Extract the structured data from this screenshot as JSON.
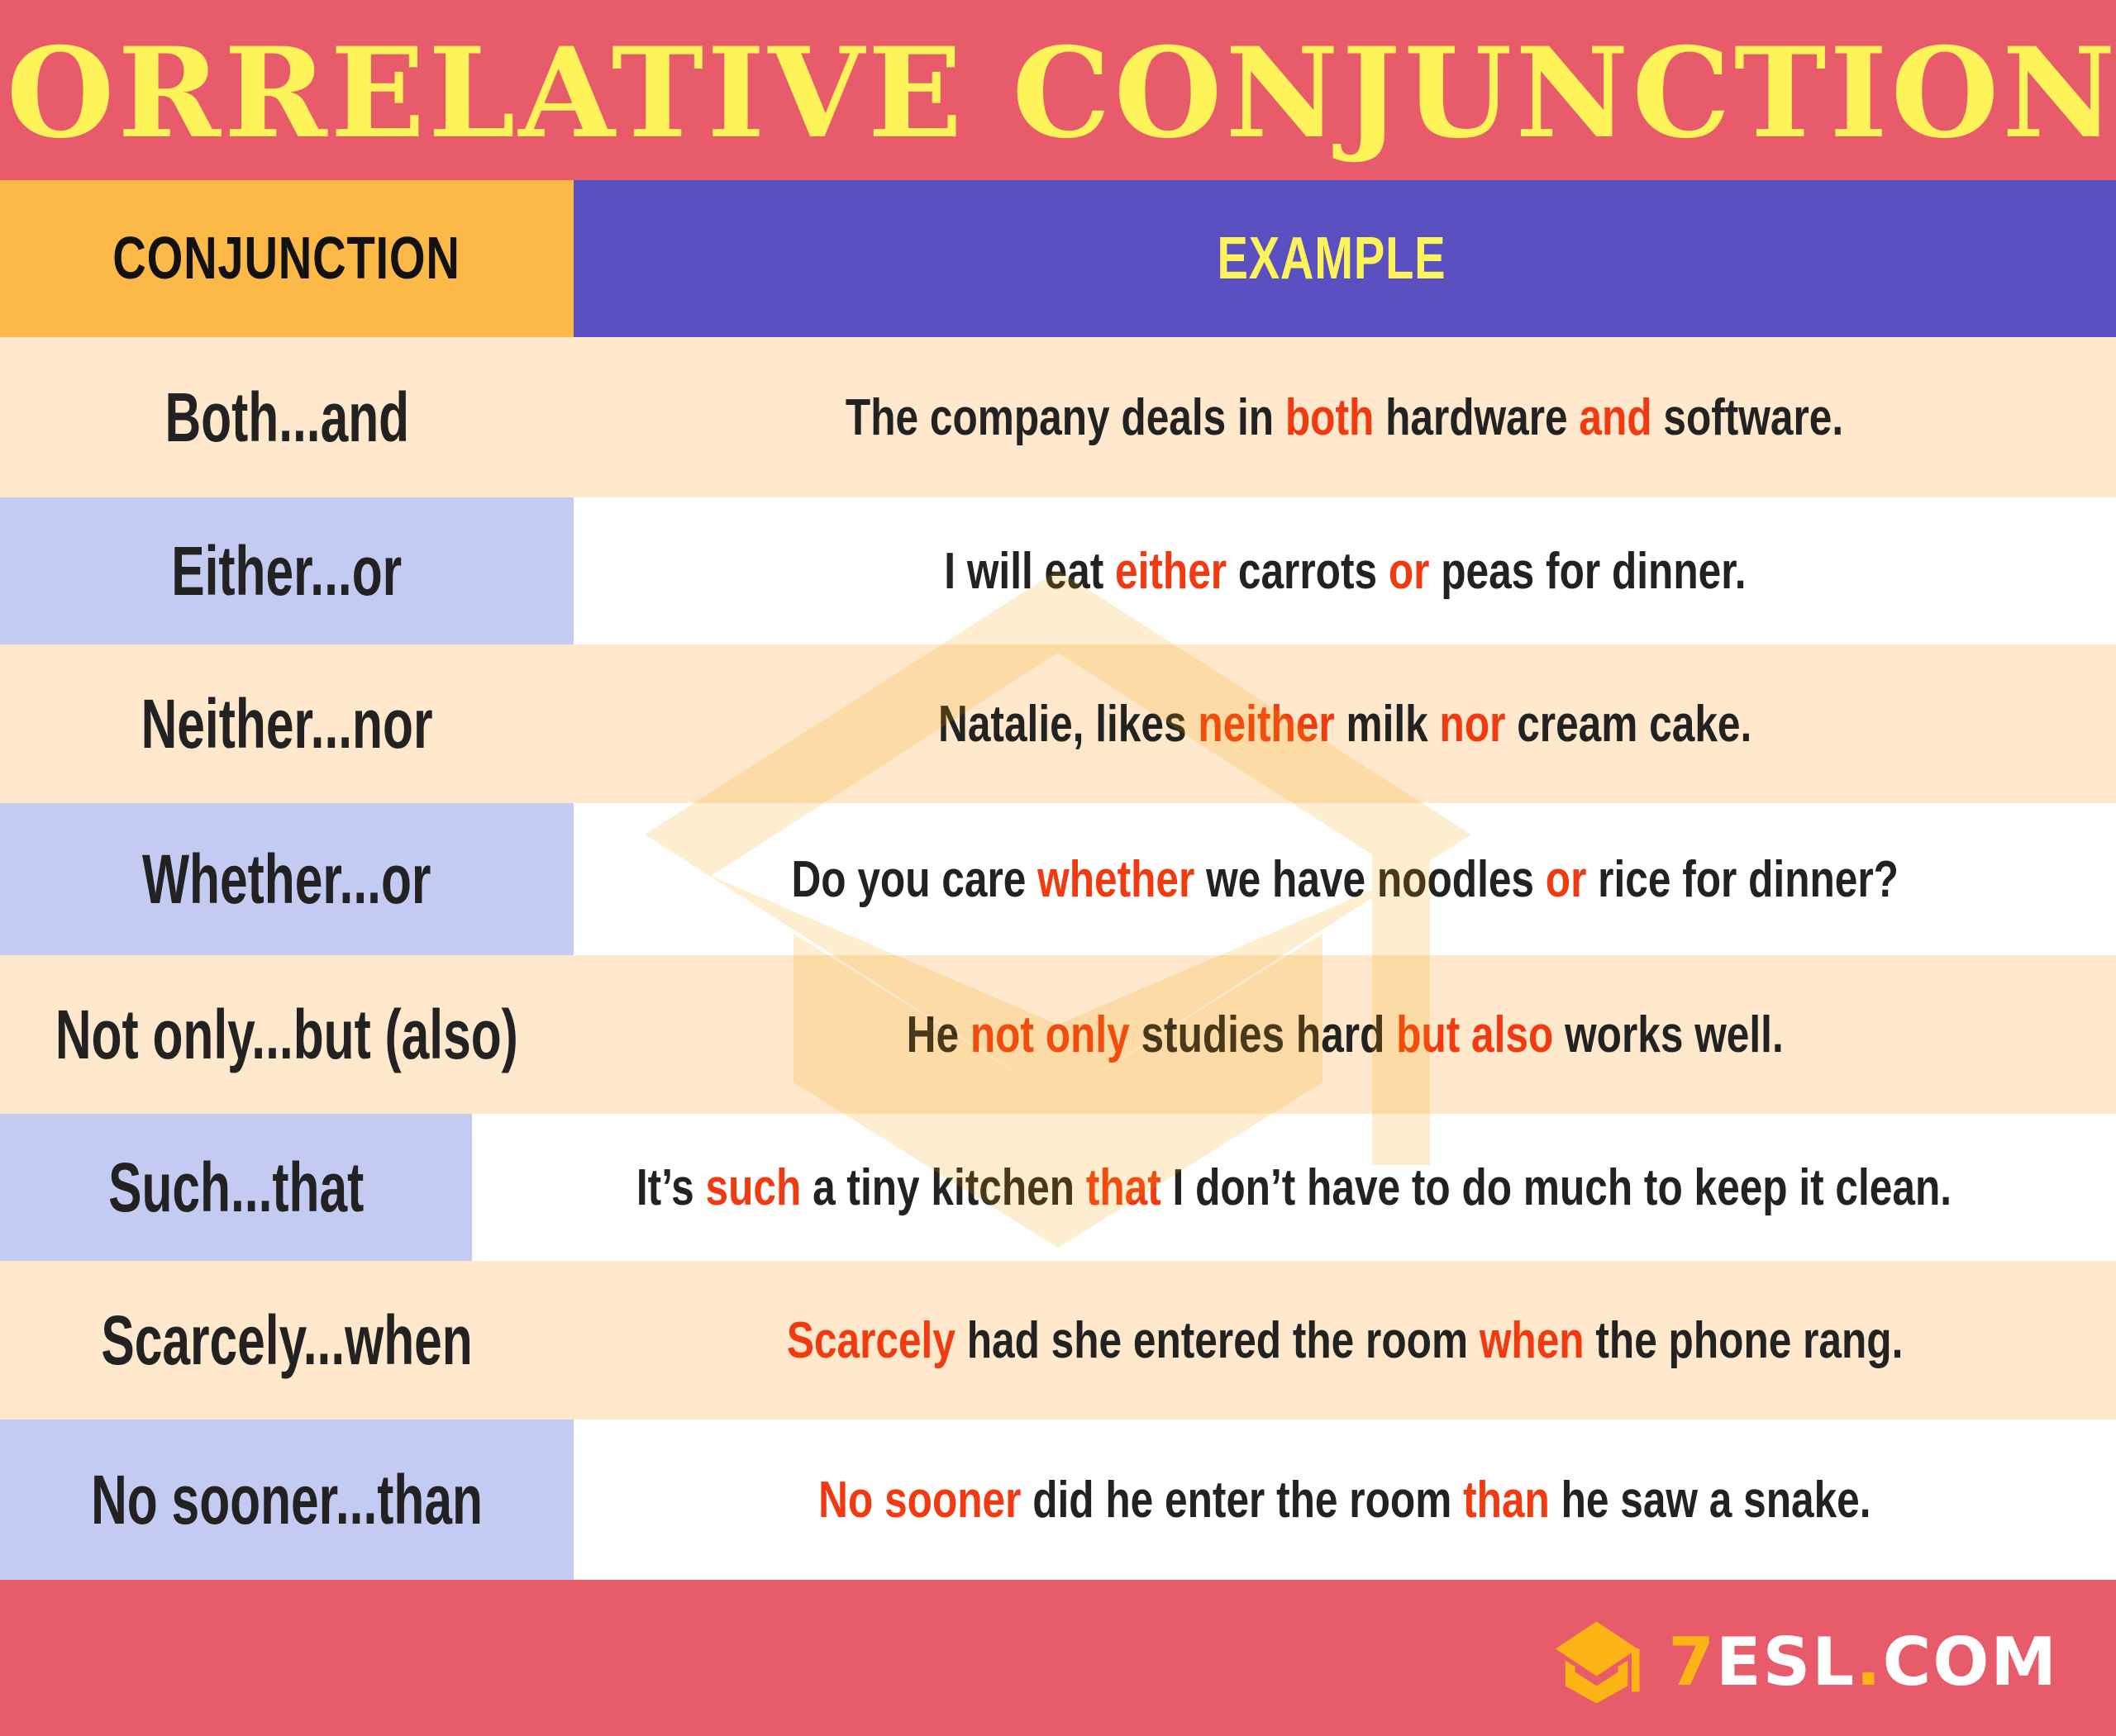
{
  "title": "CORRELATIVE CONJUNCTIONS",
  "colors": {
    "title_band": "#E75B6B",
    "title_text": "#FFF35A",
    "header_left": "#FDB948",
    "header_right": "#5B50C2",
    "row_odd": "#FFE8CC",
    "row_even_left": "#C3CBF3",
    "row_even_right": "#FFFFFF",
    "highlight": "#F23A10",
    "text": "#222222"
  },
  "table": {
    "headers": {
      "conjunction": "CONJUNCTION",
      "example": "EXAMPLE"
    },
    "rows": [
      {
        "conjunction": "Both...and",
        "example": [
          {
            "t": "The company deals in ",
            "hl": false
          },
          {
            "t": "both",
            "hl": true
          },
          {
            "t": " hardware ",
            "hl": false
          },
          {
            "t": "and",
            "hl": true
          },
          {
            "t": " software.",
            "hl": false
          }
        ]
      },
      {
        "conjunction": "Either...or",
        "example": [
          {
            "t": "I will eat ",
            "hl": false
          },
          {
            "t": "either",
            "hl": true
          },
          {
            "t": " carrots ",
            "hl": false
          },
          {
            "t": "or",
            "hl": true
          },
          {
            "t": " peas for dinner.",
            "hl": false
          }
        ]
      },
      {
        "conjunction": "Neither...nor",
        "example": [
          {
            "t": "Natalie, likes ",
            "hl": false
          },
          {
            "t": "neither",
            "hl": true
          },
          {
            "t": " milk ",
            "hl": false
          },
          {
            "t": "nor",
            "hl": true
          },
          {
            "t": " cream cake.",
            "hl": false
          }
        ]
      },
      {
        "conjunction": "Whether...or",
        "example": [
          {
            "t": "Do you care ",
            "hl": false
          },
          {
            "t": "whether",
            "hl": true
          },
          {
            "t": " we have noodles ",
            "hl": false
          },
          {
            "t": "or",
            "hl": true
          },
          {
            "t": " rice for dinner?",
            "hl": false
          }
        ]
      },
      {
        "conjunction": "Not only...but (also)",
        "example": [
          {
            "t": "He ",
            "hl": false
          },
          {
            "t": "not only",
            "hl": true
          },
          {
            "t": " studies hard ",
            "hl": false
          },
          {
            "t": "but also",
            "hl": true
          },
          {
            "t": " works well.",
            "hl": false
          }
        ]
      },
      {
        "conjunction": "Such...that",
        "example": [
          {
            "t": "It’s ",
            "hl": false
          },
          {
            "t": "such",
            "hl": true
          },
          {
            "t": " a tiny kitchen ",
            "hl": false
          },
          {
            "t": "that",
            "hl": true
          },
          {
            "t": " I don’t have to do much to keep it clean.",
            "hl": false
          }
        ]
      },
      {
        "conjunction": "Scarcely...when",
        "example": [
          {
            "t": "Scarcely",
            "hl": true
          },
          {
            "t": " had she entered the room ",
            "hl": false
          },
          {
            "t": "when",
            "hl": true
          },
          {
            "t": " the phone rang.",
            "hl": false
          }
        ]
      },
      {
        "conjunction": "No sooner...than",
        "example": [
          {
            "t": "No sooner",
            "hl": true
          },
          {
            "t": " did he enter the room ",
            "hl": false
          },
          {
            "t": "than",
            "hl": true
          },
          {
            "t": " he saw a snake.",
            "hl": false
          }
        ]
      }
    ]
  },
  "footer": {
    "logo": {
      "icon": "graduation-cap-icon",
      "seven": "7",
      "brand": "ESL",
      "dot": ".",
      "tld": "COM"
    }
  }
}
